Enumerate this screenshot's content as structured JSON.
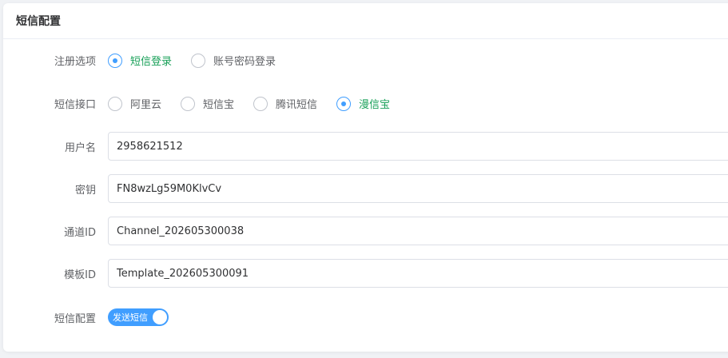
{
  "card": {
    "title": "短信配置"
  },
  "register": {
    "label": "注册选项",
    "options": [
      {
        "label": "短信登录",
        "checked": true
      },
      {
        "label": "账号密码登录",
        "checked": false
      }
    ]
  },
  "sms_provider": {
    "label": "短信接口",
    "options": [
      {
        "label": "阿里云",
        "checked": false
      },
      {
        "label": "短信宝",
        "checked": false
      },
      {
        "label": "腾讯短信",
        "checked": false
      },
      {
        "label": "漫信宝",
        "checked": true
      }
    ]
  },
  "fields": {
    "username": {
      "label": "用户名",
      "value": "2958621512"
    },
    "secret": {
      "label": "密钥",
      "value": "FN8wzLg59M0KlvCv"
    },
    "channel_id": {
      "label": "通道ID",
      "value": "Channel_202605300038"
    },
    "template_id": {
      "label": "模板ID",
      "value": "Template_202605300091"
    }
  },
  "sms_config": {
    "label": "短信配置",
    "switch_text": "发送短信",
    "enabled": true
  },
  "colors": {
    "primary": "#409eff",
    "checked_text": "#18a058",
    "border": "#dcdfe6",
    "label": "#606266"
  }
}
